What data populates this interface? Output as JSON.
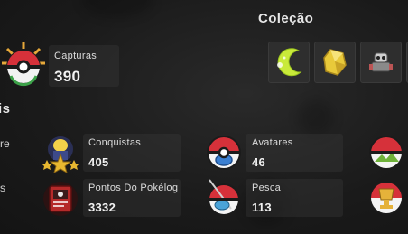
{
  "collection": {
    "title": "Coleção"
  },
  "left_partial": {
    "section_title": "is",
    "row1_label": "re",
    "row2_label": "s"
  },
  "captures": {
    "label": "Capturas",
    "value": "390",
    "icon": "pokeball-badge-icon"
  },
  "stats": [
    {
      "label": "Conquistas",
      "value": "405",
      "icon": "trophy-pokemon-icon"
    },
    {
      "label": "Avatares",
      "value": "46",
      "icon": "avatar-pokeball-icon"
    },
    {
      "label": "Pontos Do Pokélog",
      "value": "3332",
      "icon": "pokelog-icon"
    },
    {
      "label": "Pesca",
      "value": "113",
      "icon": "fishing-pokeball-icon"
    }
  ],
  "collection_items": [
    "crescent-moon-icon",
    "gold-crystal-icon",
    "trainer-figure-icon"
  ],
  "colors": {
    "red": "#d6313a",
    "blue": "#3a7fd1",
    "green": "#6fb23a",
    "gold": "#e5b23a",
    "bg": "#1a1a1a"
  }
}
